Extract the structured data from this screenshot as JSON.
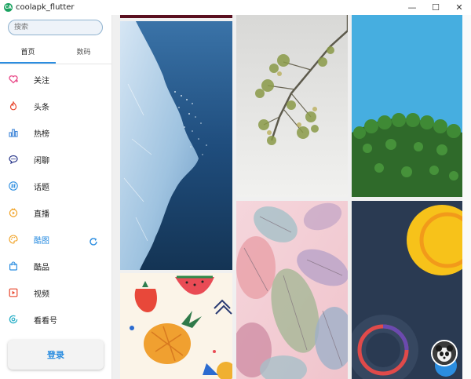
{
  "window": {
    "title": "coolapk_flutter",
    "app_icon_text": "CA",
    "minimize_glyph": "—",
    "maximize_glyph": "☐",
    "close_glyph": "✕"
  },
  "search": {
    "placeholder": "搜索"
  },
  "tabs": [
    {
      "label": "首页",
      "active": true
    },
    {
      "label": "数码",
      "active": false
    }
  ],
  "nav": [
    {
      "label": "关注",
      "icon": "heart-plus-icon",
      "color": "#e94c8a"
    },
    {
      "label": "头条",
      "icon": "flame-icon",
      "color": "#e8482f"
    },
    {
      "label": "热榜",
      "icon": "bar-chart-icon",
      "color": "#3f86d8"
    },
    {
      "label": "闲聊",
      "icon": "chat-bubble-icon",
      "color": "#2c3a8c"
    },
    {
      "label": "话题",
      "icon": "hashtag-icon",
      "color": "#2b8de0"
    },
    {
      "label": "直播",
      "icon": "live-tv-icon",
      "color": "#f0a020"
    },
    {
      "label": "酷图",
      "icon": "palette-icon",
      "color": "#f0a020",
      "active": true
    },
    {
      "label": "酷品",
      "icon": "shopping-bag-icon",
      "color": "#2b8de0"
    },
    {
      "label": "视频",
      "icon": "video-play-icon",
      "color": "#e8482f"
    },
    {
      "label": "看看号",
      "icon": "target-icon",
      "color": "#2bb0c8"
    }
  ],
  "login": {
    "label": "登录"
  },
  "colors": {
    "accent": "#2b8de0"
  }
}
